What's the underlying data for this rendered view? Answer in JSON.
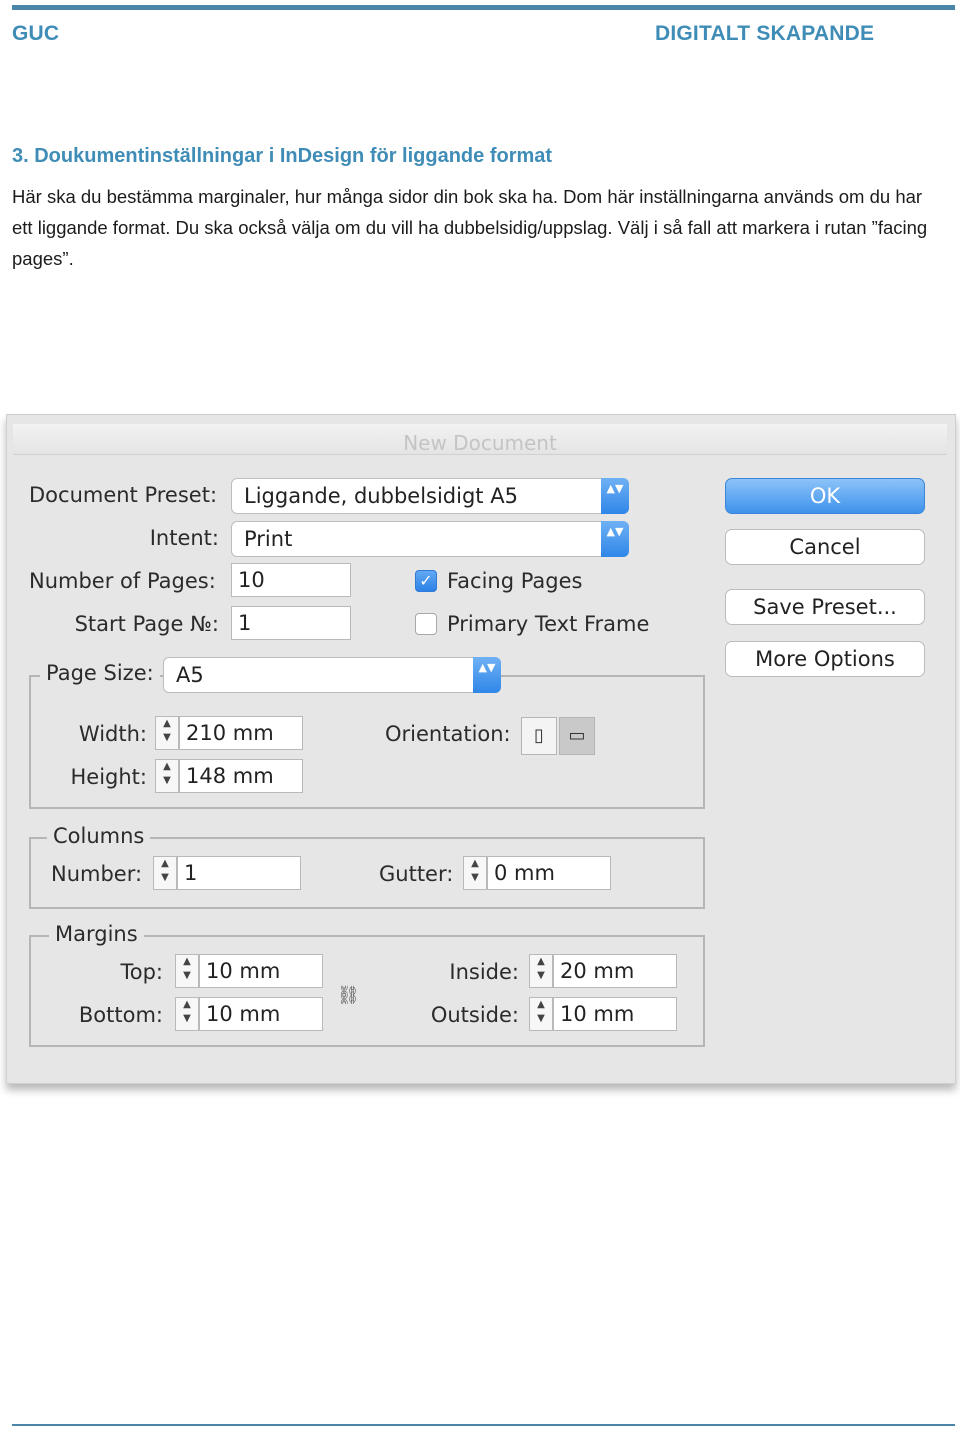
{
  "header": {
    "left": "GUC",
    "right": "DIGITALT SKAPANDE"
  },
  "section": {
    "title": "3. Doukumentinställningar i InDesign för liggande format",
    "body": "Här ska du bestämma marginaler, hur många sidor din bok ska ha. Dom här inställningarna används om du har ett liggande format. Du ska också välja om du vill ha dubbelsidig/uppslag. Välj i så fall att markera i rutan ”facing pages”."
  },
  "dialog": {
    "title": "New Document",
    "preset": {
      "label": "Document Preset:",
      "value": "Liggande, dubbelsidigt A5"
    },
    "intent": {
      "label": "Intent:",
      "value": "Print"
    },
    "num_pages": {
      "label": "Number of Pages:",
      "value": "10"
    },
    "start_page": {
      "label": "Start Page №:",
      "value": "1"
    },
    "facing_pages": {
      "label": "Facing Pages",
      "checked": true,
      "mark": "✓"
    },
    "primary_text_frame": {
      "label": "Primary Text Frame",
      "checked": false
    },
    "page_size": {
      "label": "Page Size:",
      "value": "A5",
      "width_label": "Width:",
      "width": "210 mm",
      "height_label": "Height:",
      "height": "148 mm",
      "orientation_label": "Orientation:",
      "orientation_selected": "landscape",
      "portrait_icon": "portrait-orientation-icon",
      "landscape_icon": "landscape-orientation-icon"
    },
    "columns": {
      "label": "Columns",
      "number_label": "Number:",
      "number": "1",
      "gutter_label": "Gutter:",
      "gutter": "0 mm"
    },
    "margins": {
      "label": "Margins",
      "top_label": "Top:",
      "top": "10 mm",
      "bottom_label": "Bottom:",
      "bottom": "10 mm",
      "inside_label": "Inside:",
      "inside": "20 mm",
      "outside_label": "Outside:",
      "outside": "10 mm",
      "link_icon": "chain-link-icon"
    },
    "buttons": {
      "ok": "OK",
      "cancel": "Cancel",
      "save_preset": "Save Preset...",
      "more_options": "More Options"
    }
  },
  "colors": {
    "accent": "#3f8db7",
    "rule": "#4a86a8",
    "button_blue": "#3e92ec"
  }
}
